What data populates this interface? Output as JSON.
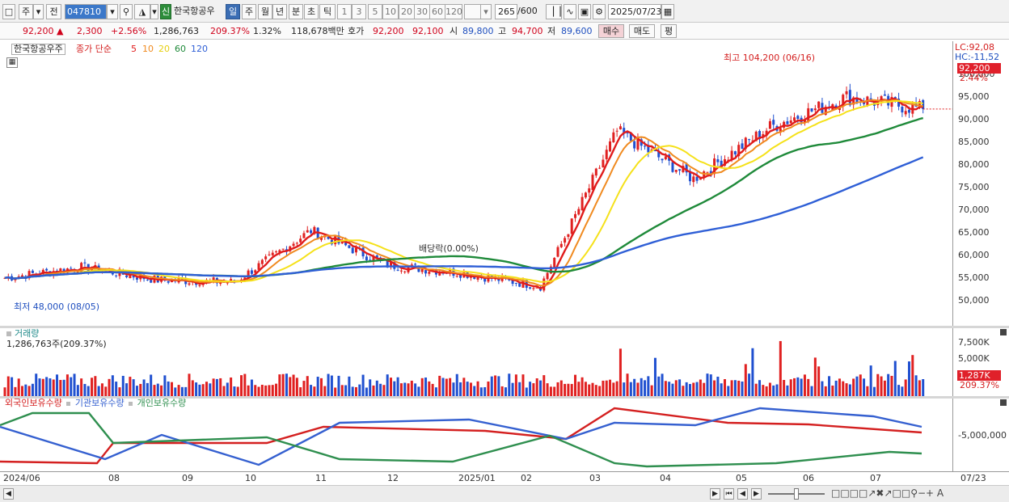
{
  "toolbar": {
    "market": "주",
    "prev": "전",
    "code": "047810",
    "stock_name": "한국항공우",
    "new_badge": "신",
    "periods": [
      "일",
      "주",
      "월",
      "년",
      "분",
      "초",
      "틱"
    ],
    "active_period": "일",
    "intervals": [
      "1",
      "3",
      "5",
      "10",
      "20",
      "30",
      "60",
      "120"
    ],
    "count": "265",
    "count_max": "/600",
    "date": "2025/07/23"
  },
  "quote": {
    "price": "92,200",
    "change": "2,300",
    "change_pct": "+2.56%",
    "volume": "1,286,763",
    "volume_ratio": "209.37%",
    "turnover": "1.32%",
    "amount": "118,678백만",
    "bid_label": "호가",
    "bid1": "92,200",
    "bid2": "92,100",
    "open_label": "시",
    "open": "89,800",
    "high_label": "고",
    "high": "94,700",
    "low_label": "저",
    "low": "89,600",
    "buy": "매수",
    "sell": "매도",
    "eval": "평"
  },
  "price_panel": {
    "title": "한국항공우주",
    "ma_label": "종가 단순",
    "ma_periods": [
      "5",
      "10",
      "20",
      "60",
      "120"
    ],
    "ma_colors": [
      "#e01c1c",
      "#f08a1f",
      "#f5e11a",
      "#1f8a3a",
      "#2f5fd6"
    ],
    "max_note": "최고 104,200 (06/16)",
    "min_note": "최저 48,000 (08/05)",
    "div_note": "배당락(0.00%)",
    "lc": "LC:92,08",
    "hc": "HC:-11,52",
    "price_tag": "92,200",
    "pct_tag": "2.44%",
    "y_ticks": [
      "100,000",
      "95,000",
      "90,000",
      "85,000",
      "80,000",
      "75,000",
      "70,000",
      "65,000",
      "60,000",
      "55,000",
      "50,000"
    ]
  },
  "volume_panel": {
    "title": "거래량",
    "value": "1,286,763주(209.37%)",
    "y_ticks": [
      "7,500K",
      "5,000K",
      "2,500K"
    ],
    "tag": "1,287K",
    "tag_pct": "209.37%"
  },
  "holder_panel": {
    "series": [
      "외국인보유수량",
      "기관보유수량",
      "개인보유수량"
    ],
    "colors": [
      "#d42020",
      "#3560d0",
      "#2f8f4f"
    ],
    "y_tick": "-5,000,000"
  },
  "x_axis": [
    "2024/06",
    "08",
    "09",
    "10",
    "11",
    "12",
    "2025/01",
    "02",
    "03",
    "04",
    "05",
    "06",
    "07"
  ],
  "x_right": "07/23",
  "chart_data": {
    "type": "candlestick",
    "x_range": [
      "2024/06",
      "2025/07/23"
    ],
    "ylim": [
      46000,
      104200
    ],
    "max": {
      "value": 104200,
      "date": "06/16"
    },
    "min": {
      "value": 48000,
      "date": "08/05"
    },
    "last_close": 92200,
    "monthly_close_approx": {
      "categories": [
        "2024/06",
        "08",
        "09",
        "10",
        "11",
        "12",
        "2025/01",
        "02",
        "03",
        "04",
        "05",
        "06",
        "07"
      ],
      "values": [
        53000,
        55500,
        52500,
        52000,
        64000,
        56000,
        54000,
        51000,
        87000,
        76000,
        88000,
        95000,
        92200
      ]
    }
  }
}
